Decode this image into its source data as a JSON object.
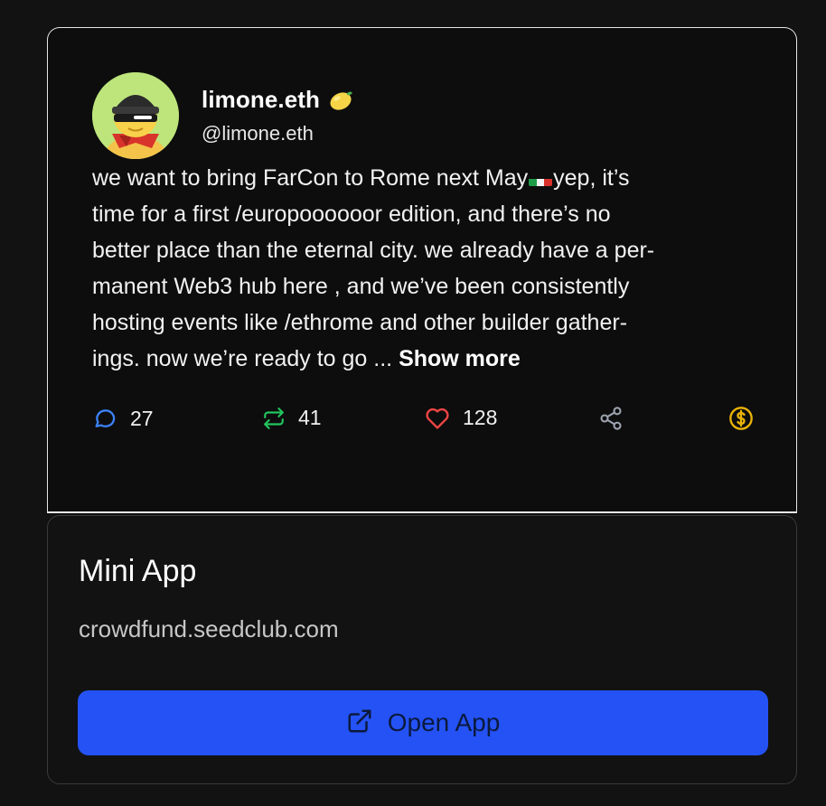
{
  "cast": {
    "display_name": "limone.eth",
    "username": "@limone.eth",
    "text": {
      "line1_a": "we want to bring FarCon to Rome next May",
      "line1_b": "yep, it’s",
      "line2": "time for a first /europoooooor edition, and there’s no",
      "line3": "better place than the eternal city. we already have a per-",
      "line4": "manent Web3 hub here , and we’ve been consistently",
      "line5": "hosting events like /ethrome and other builder gather-",
      "line6": "ings. now we’re ready to go ... ",
      "show_more": "Show more"
    },
    "actions": {
      "replies": "27",
      "recasts": "41",
      "likes": "128"
    },
    "icons": {
      "reply": "comment-icon",
      "recast": "recast-icon",
      "like": "heart-icon",
      "share": "share-icon",
      "tip": "dollar-coin-icon",
      "emoji": "lemon-icon",
      "flag": "italy-flag-icon"
    },
    "colors": {
      "reply": "#3b82f6",
      "recast": "#22c55e",
      "like": "#ef4444",
      "share": "#9ca3af",
      "tip": "#eab308"
    }
  },
  "mini_app": {
    "title": "Mini App",
    "url": "crowdfund.seedclub.com",
    "button_label": "Open App",
    "button_color": "#2452f5"
  }
}
